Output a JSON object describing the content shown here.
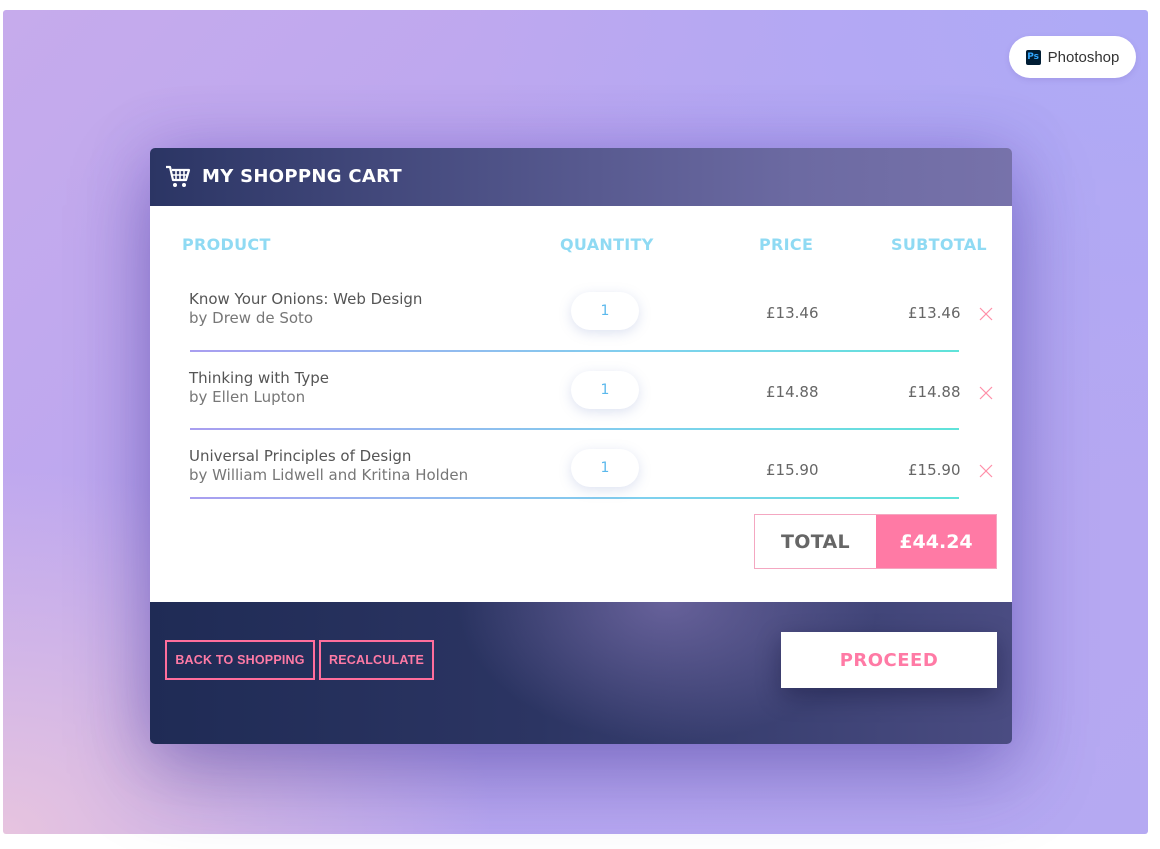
{
  "app_badge": {
    "icon": "photoshop-icon",
    "icon_text": "Ps",
    "label": "Photoshop"
  },
  "cart": {
    "icon": "shopping-cart-icon",
    "title": "MY SHOPPNG CART",
    "columns": {
      "product": "PRODUCT",
      "quantity": "QUANTITY",
      "price": "PRICE",
      "subtotal": "SUBTOTAL"
    },
    "items": [
      {
        "title": "Know Your Onions: Web Design",
        "author": "by Drew de Soto",
        "quantity": "1",
        "price": "£13.46",
        "subtotal": "£13.46"
      },
      {
        "title": "Thinking with Type",
        "author": "by Ellen Lupton",
        "quantity": "1",
        "price": "£14.88",
        "subtotal": "£14.88"
      },
      {
        "title": "Universal Principles of Design",
        "author": "by William Lidwell and Kritina Holden",
        "quantity": "1",
        "price": "£15.90",
        "subtotal": "£15.90"
      }
    ],
    "total_label": "TOTAL",
    "total_value": "£44.24"
  },
  "footer": {
    "back_label": "BACK TO SHOPPING",
    "recalculate_label": "RECALCULATE",
    "proceed_label": "PROCEED"
  },
  "colors": {
    "accent_pink": "#ff7aa5",
    "column_header": "#8fdaf3",
    "quantity_text": "#5ab8ec",
    "header_dark": "#2b3564"
  }
}
